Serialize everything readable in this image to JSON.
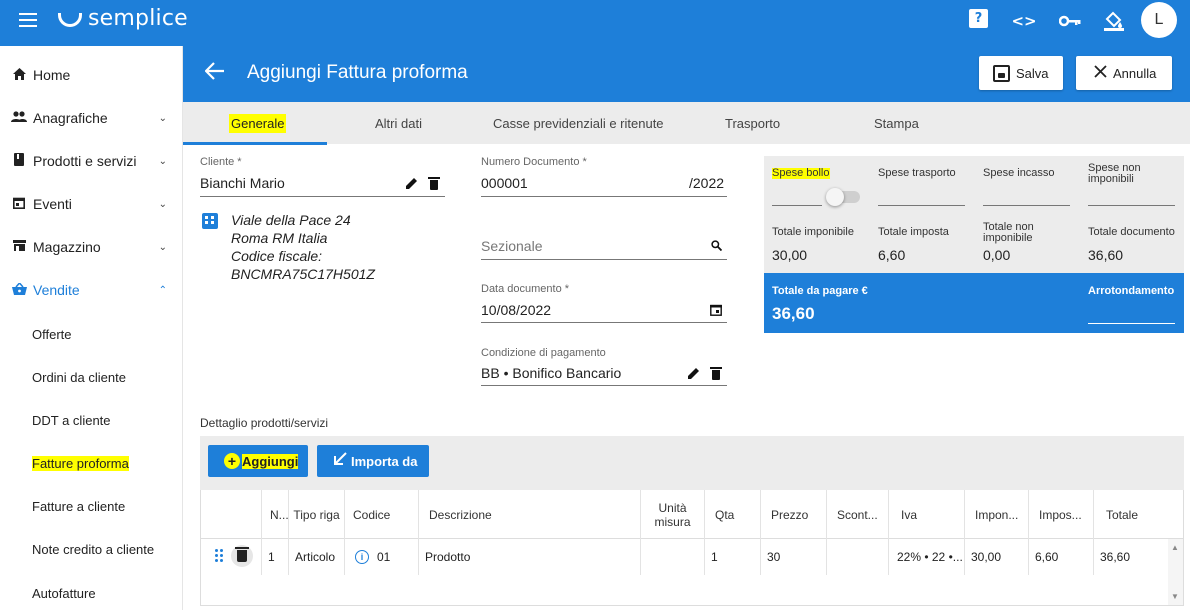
{
  "app": {
    "name": "semplice",
    "avatar_letter": "L"
  },
  "topbar_icons": {
    "help": "?",
    "code": "<>",
    "key": "key-icon",
    "paint": "paint-bucket-icon"
  },
  "sidebar": {
    "items": [
      {
        "label": "Home",
        "icon": "home-icon"
      },
      {
        "label": "Anagrafiche",
        "icon": "people-icon"
      },
      {
        "label": "Prodotti e servizi",
        "icon": "book-icon"
      },
      {
        "label": "Eventi",
        "icon": "calendar-icon"
      },
      {
        "label": "Magazzino",
        "icon": "warehouse-icon"
      },
      {
        "label": "Vendite",
        "icon": "basket-icon"
      }
    ],
    "vendite_sub": [
      "Offerte",
      "Ordini da cliente",
      "DDT a cliente",
      "Fatture proforma",
      "Fatture a cliente",
      "Note credito a cliente",
      "Autofatture"
    ]
  },
  "header": {
    "title": "Aggiungi Fattura proforma",
    "save_label": "Salva",
    "cancel_label": "Annulla"
  },
  "tabs": [
    "Generale",
    "Altri dati",
    "Casse previdenziali e ritenute",
    "Trasporto",
    "Stampa"
  ],
  "form": {
    "cliente_label": "Cliente *",
    "cliente_value": "Bianchi Mario",
    "address": [
      "Viale della Pace 24",
      "Roma RM Italia",
      "Codice fiscale:",
      "BNCMRA75C17H501Z"
    ],
    "numero_label": "Numero Documento *",
    "numero_value": "000001",
    "numero_suffix": "/2022",
    "sezionale_placeholder": "Sezionale",
    "data_label": "Data documento *",
    "data_value": "10/08/2022",
    "condizione_label": "Condizione di pagamento",
    "condizione_value": "BB • Bonifico Bancario"
  },
  "totals": {
    "spese_bollo": "Spese bollo",
    "spese_trasporto": "Spese trasporto",
    "spese_incasso": "Spese incasso",
    "spese_non_imponibili": "Spese non imponibili",
    "totale_imponibile_label": "Totale imponibile",
    "totale_imponibile": "30,00",
    "totale_imposta_label": "Totale imposta",
    "totale_imposta": "6,60",
    "totale_non_imponibile_label": "Totale non imponibile",
    "totale_non_imponibile": "0,00",
    "totale_documento_label": "Totale documento",
    "totale_documento": "36,60",
    "da_pagare_label": "Totale da pagare €",
    "da_pagare": "36,60",
    "arrotondamento_label": "Arrotondamento"
  },
  "details": {
    "title": "Dettaglio prodotti/servizi",
    "add_label": "Aggiungi",
    "import_label": "Importa da",
    "columns": [
      "N...",
      "Tipo riga",
      "Codice",
      "Descrizione",
      "Unità misura",
      "Qta",
      "Prezzo",
      "Scont...",
      "Iva",
      "Impon...",
      "Impos...",
      "Totale"
    ],
    "rows": [
      {
        "n": "1",
        "tipo": "Articolo",
        "codice": "01",
        "descrizione": "Prodotto",
        "unita": "",
        "qta": "1",
        "prezzo": "30",
        "sconto": "",
        "iva": "22% • 22 •...",
        "imponibile": "30,00",
        "imposta": "6,60",
        "totale": "36,60"
      }
    ]
  },
  "colors": {
    "primary": "#1e7fd9",
    "highlight": "#ffff00",
    "panel": "#ececec"
  }
}
